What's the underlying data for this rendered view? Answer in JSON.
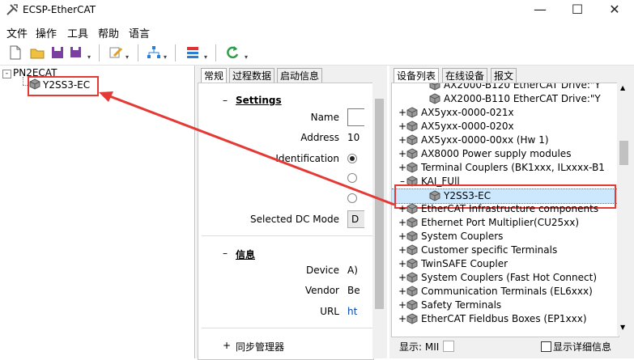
{
  "window": {
    "title": "ECSP-EtherCAT",
    "minimize": "—",
    "maximize": "☐",
    "close": "✕"
  },
  "menu": [
    "文件",
    "操作",
    "工具",
    "帮助",
    "语言"
  ],
  "tree": {
    "root": "PN2ECAT",
    "child": "Y2SS3-EC"
  },
  "middle": {
    "tabs": [
      "常规",
      "过程数据",
      "启动信息"
    ],
    "settings": {
      "heading": "Settings",
      "toggle": "–",
      "name_label": "Name",
      "address_label": "Address",
      "address_value": "10",
      "identification_label": "Identification",
      "dc_label": "Selected DC Mode",
      "dc_value": "D"
    },
    "info": {
      "heading": "信息",
      "toggle": "–",
      "device_label": "Device",
      "device_value": "A)",
      "vendor_label": "Vendor",
      "vendor_value": "Be",
      "url_label": "URL",
      "url_value": "ht"
    },
    "sync": {
      "heading": "同步管理器",
      "toggle": "+"
    }
  },
  "right": {
    "tabs": [
      "设备列表",
      "在线设备",
      "报文"
    ],
    "items": [
      {
        "text": "AX2000-B120 EtherCAT Drive:\"Y",
        "exp": "",
        "indent": 2
      },
      {
        "text": "AX2000-B110 EtherCAT Drive:\"Y",
        "exp": "",
        "indent": 2
      },
      {
        "text": "AX5yxx-0000-021x",
        "exp": "+",
        "indent": 1
      },
      {
        "text": "AX5yxx-0000-020x",
        "exp": "+",
        "indent": 1
      },
      {
        "text": "AX5yxx-0000-00xx (Hw 1)",
        "exp": "+",
        "indent": 1
      },
      {
        "text": "AX8000 Power supply modules",
        "exp": "+",
        "indent": 1
      },
      {
        "text": "Terminal Couplers (BK1xxx, ILxxxx-B1",
        "exp": "+",
        "indent": 1
      },
      {
        "text": "KAI_FUll",
        "exp": "–",
        "indent": 1
      },
      {
        "text": "Y2SS3-EC",
        "exp": "",
        "indent": 2
      },
      {
        "text": "EtherCAT Infrastructure components",
        "exp": "+",
        "indent": 1
      },
      {
        "text": "Ethernet Port Multiplier(CU25xx)",
        "exp": "+",
        "indent": 1
      },
      {
        "text": "System Couplers",
        "exp": "+",
        "indent": 1
      },
      {
        "text": "Customer specific Terminals",
        "exp": "+",
        "indent": 1
      },
      {
        "text": "TwinSAFE Coupler",
        "exp": "+",
        "indent": 1
      },
      {
        "text": "System Couplers (Fast Hot Connect)",
        "exp": "+",
        "indent": 1
      },
      {
        "text": "Communication Terminals (EL6xxx)",
        "exp": "+",
        "indent": 1
      },
      {
        "text": "Safety Terminals",
        "exp": "+",
        "indent": 1
      },
      {
        "text": "EtherCAT Fieldbus Boxes (EP1xxx)",
        "exp": "+",
        "indent": 1
      }
    ],
    "status_left": "显示: MII",
    "status_check": "显示详细信息"
  },
  "colors": {
    "highlight": "#e53935",
    "selection": "#cce8ff",
    "link": "#0645ad"
  }
}
